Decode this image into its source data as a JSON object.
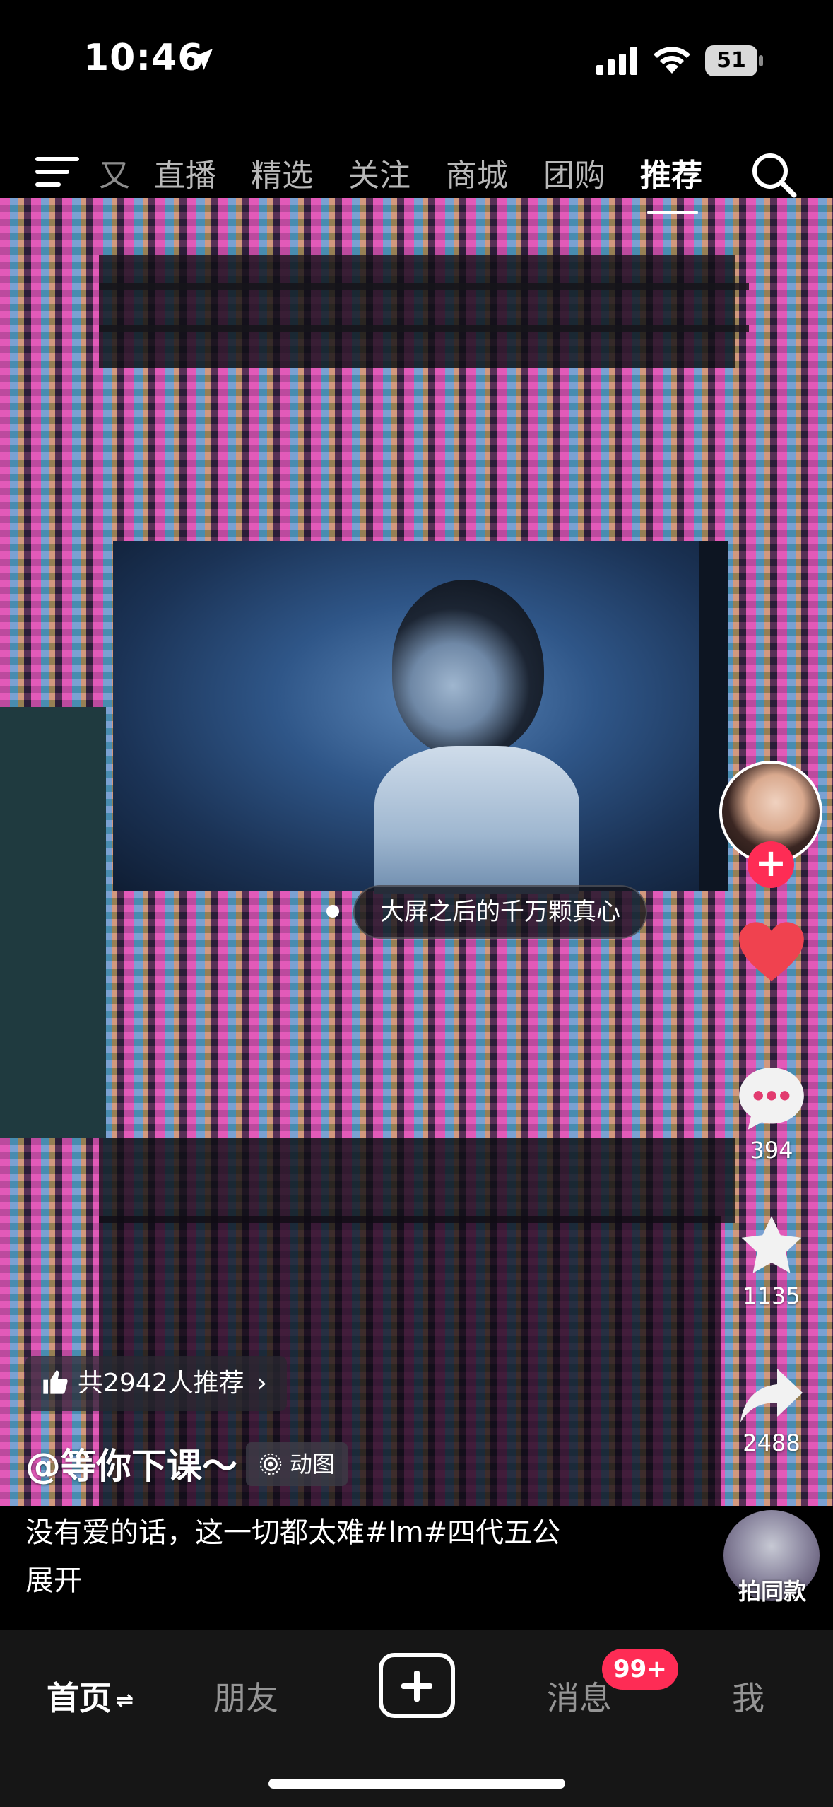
{
  "status_bar": {
    "time": "10:46",
    "battery": "51"
  },
  "top_nav": {
    "clipped_tab": "又",
    "tabs": [
      {
        "label": "直播"
      },
      {
        "label": "精选"
      },
      {
        "label": "关注"
      },
      {
        "label": "商城"
      },
      {
        "label": "团购"
      },
      {
        "label": "推荐",
        "active": true
      }
    ]
  },
  "video": {
    "caption": "大屏之后的千万颗真心",
    "author": "@等你下课～",
    "tag": "动图",
    "recommend": "共2942人推荐",
    "description": "没有爱的话，这一切都太难#lm#四代五公",
    "expand": "展开"
  },
  "actions": {
    "comments": "394",
    "favorites": "1135",
    "shares": "2488",
    "same_style": "拍同款"
  },
  "tab_bar": {
    "home": "首页",
    "friends": "朋友",
    "messages": "消息",
    "messages_badge": "99+",
    "me": "我"
  },
  "colors": {
    "accent": "#fe2c55",
    "like": "#f0424f"
  }
}
